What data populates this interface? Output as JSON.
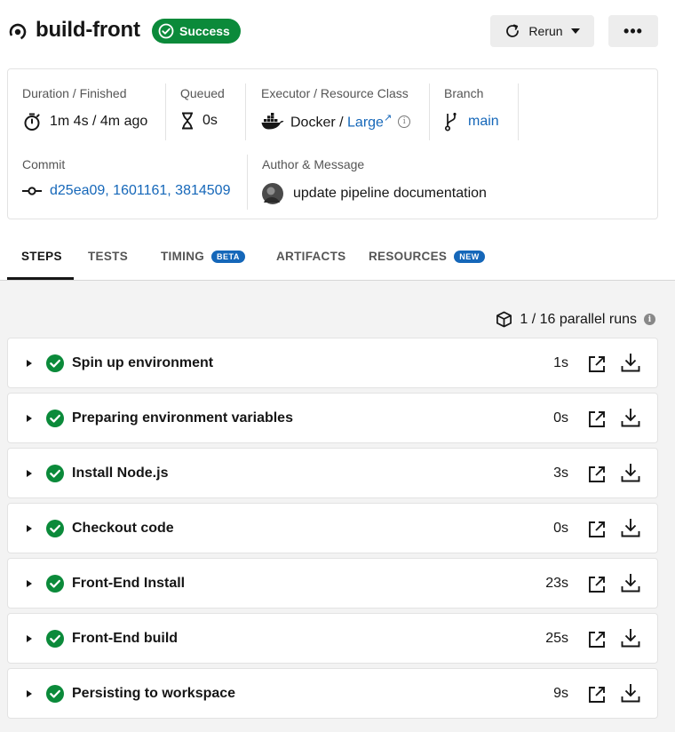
{
  "header": {
    "title": "build-front",
    "status": "Success",
    "rerun_label": "Rerun",
    "more_label": "•••"
  },
  "info": {
    "duration": {
      "label": "Duration / Finished",
      "value": "1m 4s / 4m ago"
    },
    "queued": {
      "label": "Queued",
      "value": "0s"
    },
    "executor": {
      "label": "Executor / Resource Class",
      "value": "Docker / ",
      "resource": "Large",
      "ext_mark": "↗",
      "info_mark": "i"
    },
    "branch": {
      "label": "Branch",
      "value": "main"
    },
    "commit": {
      "label": "Commit",
      "value": "d25ea09, 1601161, 3814509"
    },
    "author": {
      "label": "Author & Message",
      "value": "update pipeline documentation"
    }
  },
  "tabs": [
    {
      "label": "STEPS",
      "active": true
    },
    {
      "label": "TESTS"
    },
    {
      "label": "TIMING",
      "badge": "BETA"
    },
    {
      "label": "ARTIFACTS"
    },
    {
      "label": "RESOURCES",
      "badge": "NEW"
    }
  ],
  "parallel": {
    "text": "1 / 16 parallel runs",
    "info_mark": "i"
  },
  "steps": [
    {
      "name": "Spin up environment",
      "duration": "1s"
    },
    {
      "name": "Preparing environment variables",
      "duration": "0s"
    },
    {
      "name": "Install Node.js",
      "duration": "3s"
    },
    {
      "name": "Checkout code",
      "duration": "0s"
    },
    {
      "name": "Front-End Install",
      "duration": "23s"
    },
    {
      "name": "Front-End build",
      "duration": "25s"
    },
    {
      "name": "Persisting to workspace",
      "duration": "9s"
    }
  ],
  "colors": {
    "success": "#0b8a3a",
    "link": "#1567b9",
    "badge": "#1567b9"
  }
}
